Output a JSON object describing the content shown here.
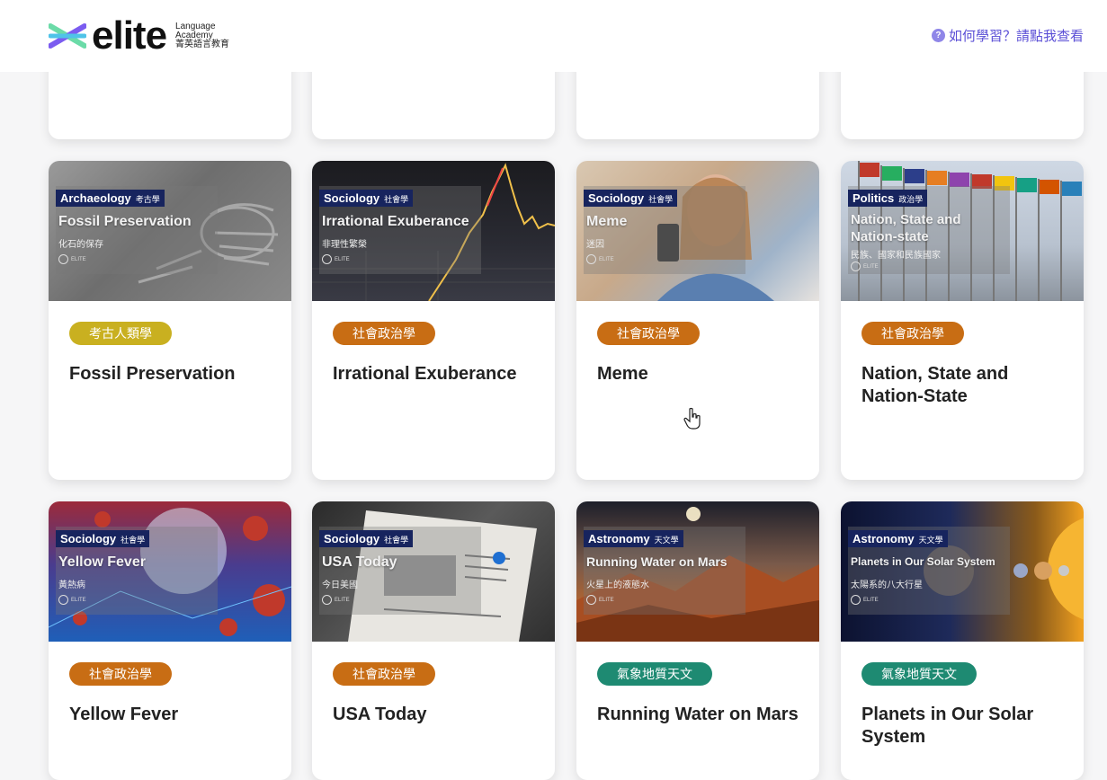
{
  "header": {
    "logo_word": "elite",
    "logo_sub_1": "Language",
    "logo_sub_2": "Academy",
    "logo_sub_3": "菁英語言教育",
    "help_icon": "?",
    "help_text": "如何學習？請點我查看"
  },
  "colors": {
    "accent": "#5b4fd6",
    "pill_archaeology": "#c9b020",
    "pill_social": "#c86d14",
    "pill_science": "#1e8a72",
    "subject_tag_bg": "#17245e"
  },
  "icons": {
    "cursor": "hand-pointer-icon",
    "help": "question-bubble-icon",
    "logo": "elite-logo-mark"
  },
  "cards": [
    {
      "subject": "Archaeology",
      "subject_zh": "考古學",
      "thumb_title": "Fossil Preservation",
      "thumb_subtitle": "化石的保存",
      "brand": "ELITE",
      "category": "考古人類學",
      "title": "Fossil Preservation"
    },
    {
      "subject": "Sociology",
      "subject_zh": "社會學",
      "thumb_title": "Irrational Exuberance",
      "thumb_subtitle": "非理性繁榮",
      "brand": "ELITE",
      "category": "社會政治學",
      "title": "Irrational Exuberance"
    },
    {
      "subject": "Sociology",
      "subject_zh": "社會學",
      "thumb_title": "Meme",
      "thumb_subtitle": "迷因",
      "brand": "ELITE",
      "category": "社會政治學",
      "title": "Meme"
    },
    {
      "subject": "Politics",
      "subject_zh": "政治學",
      "thumb_title": "Nation, State and Nation-state",
      "thumb_subtitle": "民族、國家和民族國家",
      "brand": "ELITE",
      "category": "社會政治學",
      "title": "Nation, State and Nation-State"
    },
    {
      "subject": "Sociology",
      "subject_zh": "社會學",
      "thumb_title": "Yellow Fever",
      "thumb_subtitle": "黃熱病",
      "brand": "ELITE",
      "category": "社會政治學",
      "title": "Yellow Fever"
    },
    {
      "subject": "Sociology",
      "subject_zh": "社會學",
      "thumb_title": "USA Today",
      "thumb_subtitle": "今日美國",
      "brand": "ELITE",
      "category": "社會政治學",
      "title": "USA Today"
    },
    {
      "subject": "Astronomy",
      "subject_zh": "天文學",
      "thumb_title": "Running Water on Mars",
      "thumb_subtitle": "火星上的液態水",
      "brand": "ELITE",
      "category": "氣象地質天文",
      "title": "Running Water on Mars"
    },
    {
      "subject": "Astronomy",
      "subject_zh": "天文學",
      "thumb_title": "Planets in Our Solar System",
      "thumb_subtitle": "太陽系的八大行星",
      "brand": "ELITE",
      "category": "氣象地質天文",
      "title": "Planets in Our Solar System"
    }
  ]
}
